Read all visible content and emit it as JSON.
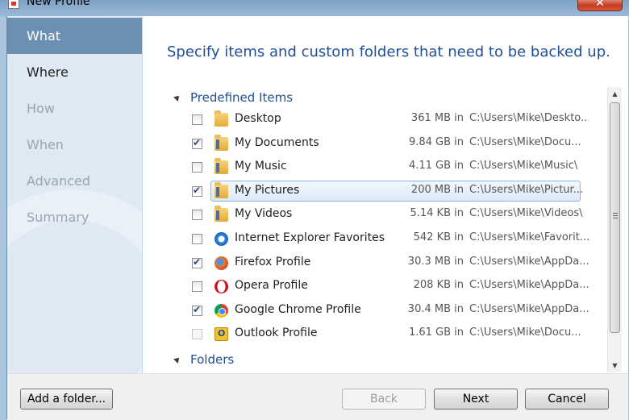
{
  "window": {
    "title": "New Profile",
    "close_glyph": "✕"
  },
  "sidebar": {
    "items": [
      {
        "label": "What",
        "state": "active"
      },
      {
        "label": "Where",
        "state": "enabled"
      },
      {
        "label": "How",
        "state": "disabled"
      },
      {
        "label": "When",
        "state": "disabled"
      },
      {
        "label": "Advanced",
        "state": "disabled"
      },
      {
        "label": "Summary",
        "state": "disabled"
      }
    ]
  },
  "main": {
    "heading": "Specify items and custom folders that need to be backed up.",
    "groups": {
      "predefined": "Predefined Items",
      "folders": "Folders"
    },
    "items": [
      {
        "name": "Desktop",
        "icon": "folder-icon",
        "checked": false,
        "size": "361 MB in",
        "path": "C:\\Users\\Mike\\Deskto..."
      },
      {
        "name": "My Documents",
        "icon": "documents-library-icon",
        "checked": true,
        "size": "9.84 GB in",
        "path": "C:\\Users\\Mike\\Docu..."
      },
      {
        "name": "My Music",
        "icon": "music-library-icon",
        "checked": false,
        "size": "4.11 GB in",
        "path": "C:\\Users\\Mike\\Music\\"
      },
      {
        "name": "My Pictures",
        "icon": "pictures-library-icon",
        "checked": true,
        "size": "200 MB in",
        "path": "C:\\Users\\Mike\\Pictur...",
        "selected": true
      },
      {
        "name": "My Videos",
        "icon": "videos-library-icon",
        "checked": false,
        "size": "5.14 KB in",
        "path": "C:\\Users\\Mike\\Videos\\"
      },
      {
        "name": "Internet Explorer Favorites",
        "icon": "internet-explorer-icon",
        "checked": false,
        "size": "542 KB in",
        "path": "C:\\Users\\Mike\\Favorit..."
      },
      {
        "name": "Firefox Profile",
        "icon": "firefox-icon",
        "checked": true,
        "size": "30.3 MB in",
        "path": "C:\\Users\\Mike\\AppDa..."
      },
      {
        "name": "Opera Profile",
        "icon": "opera-icon",
        "checked": false,
        "size": "208 KB in",
        "path": "C:\\Users\\Mike\\AppDa..."
      },
      {
        "name": "Google Chrome Profile",
        "icon": "chrome-icon",
        "checked": true,
        "size": "30.4 MB in",
        "path": "C:\\Users\\Mike\\AppDa..."
      },
      {
        "name": "Outlook Profile",
        "icon": "outlook-icon",
        "checked": false,
        "disabled": true,
        "size": "1.61 GB in",
        "path": "C:\\Users\\Mike\\Docu..."
      }
    ]
  },
  "footer": {
    "add_folder": "Add a folder...",
    "back": "Back",
    "next": "Next",
    "cancel": "Cancel"
  },
  "colors": {
    "sidebar_active": "#6c8fb4",
    "heading": "#1f4f95",
    "selection_border": "#89b3e0"
  }
}
